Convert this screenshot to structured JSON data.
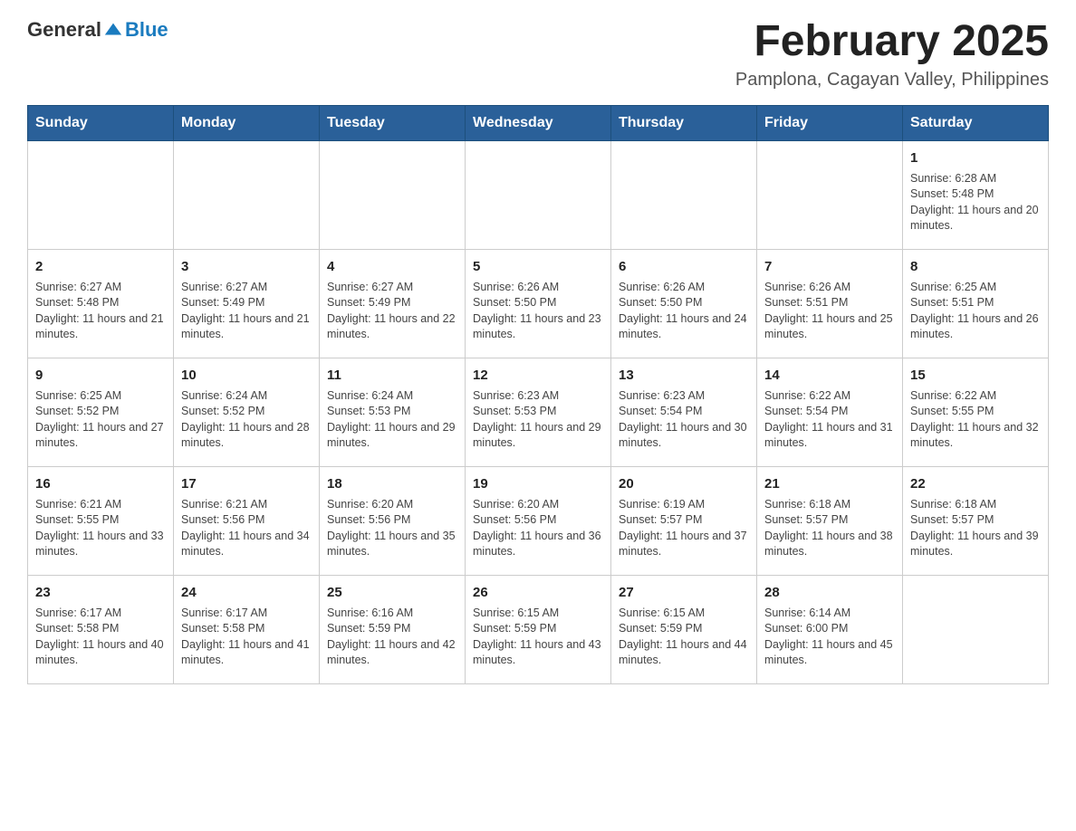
{
  "header": {
    "logo_general": "General",
    "logo_blue": "Blue",
    "title": "February 2025",
    "subtitle": "Pamplona, Cagayan Valley, Philippines"
  },
  "days_of_week": [
    "Sunday",
    "Monday",
    "Tuesday",
    "Wednesday",
    "Thursday",
    "Friday",
    "Saturday"
  ],
  "weeks": [
    [
      {
        "day": "",
        "info": ""
      },
      {
        "day": "",
        "info": ""
      },
      {
        "day": "",
        "info": ""
      },
      {
        "day": "",
        "info": ""
      },
      {
        "day": "",
        "info": ""
      },
      {
        "day": "",
        "info": ""
      },
      {
        "day": "1",
        "info": "Sunrise: 6:28 AM\nSunset: 5:48 PM\nDaylight: 11 hours and 20 minutes."
      }
    ],
    [
      {
        "day": "2",
        "info": "Sunrise: 6:27 AM\nSunset: 5:48 PM\nDaylight: 11 hours and 21 minutes."
      },
      {
        "day": "3",
        "info": "Sunrise: 6:27 AM\nSunset: 5:49 PM\nDaylight: 11 hours and 21 minutes."
      },
      {
        "day": "4",
        "info": "Sunrise: 6:27 AM\nSunset: 5:49 PM\nDaylight: 11 hours and 22 minutes."
      },
      {
        "day": "5",
        "info": "Sunrise: 6:26 AM\nSunset: 5:50 PM\nDaylight: 11 hours and 23 minutes."
      },
      {
        "day": "6",
        "info": "Sunrise: 6:26 AM\nSunset: 5:50 PM\nDaylight: 11 hours and 24 minutes."
      },
      {
        "day": "7",
        "info": "Sunrise: 6:26 AM\nSunset: 5:51 PM\nDaylight: 11 hours and 25 minutes."
      },
      {
        "day": "8",
        "info": "Sunrise: 6:25 AM\nSunset: 5:51 PM\nDaylight: 11 hours and 26 minutes."
      }
    ],
    [
      {
        "day": "9",
        "info": "Sunrise: 6:25 AM\nSunset: 5:52 PM\nDaylight: 11 hours and 27 minutes."
      },
      {
        "day": "10",
        "info": "Sunrise: 6:24 AM\nSunset: 5:52 PM\nDaylight: 11 hours and 28 minutes."
      },
      {
        "day": "11",
        "info": "Sunrise: 6:24 AM\nSunset: 5:53 PM\nDaylight: 11 hours and 29 minutes."
      },
      {
        "day": "12",
        "info": "Sunrise: 6:23 AM\nSunset: 5:53 PM\nDaylight: 11 hours and 29 minutes."
      },
      {
        "day": "13",
        "info": "Sunrise: 6:23 AM\nSunset: 5:54 PM\nDaylight: 11 hours and 30 minutes."
      },
      {
        "day": "14",
        "info": "Sunrise: 6:22 AM\nSunset: 5:54 PM\nDaylight: 11 hours and 31 minutes."
      },
      {
        "day": "15",
        "info": "Sunrise: 6:22 AM\nSunset: 5:55 PM\nDaylight: 11 hours and 32 minutes."
      }
    ],
    [
      {
        "day": "16",
        "info": "Sunrise: 6:21 AM\nSunset: 5:55 PM\nDaylight: 11 hours and 33 minutes."
      },
      {
        "day": "17",
        "info": "Sunrise: 6:21 AM\nSunset: 5:56 PM\nDaylight: 11 hours and 34 minutes."
      },
      {
        "day": "18",
        "info": "Sunrise: 6:20 AM\nSunset: 5:56 PM\nDaylight: 11 hours and 35 minutes."
      },
      {
        "day": "19",
        "info": "Sunrise: 6:20 AM\nSunset: 5:56 PM\nDaylight: 11 hours and 36 minutes."
      },
      {
        "day": "20",
        "info": "Sunrise: 6:19 AM\nSunset: 5:57 PM\nDaylight: 11 hours and 37 minutes."
      },
      {
        "day": "21",
        "info": "Sunrise: 6:18 AM\nSunset: 5:57 PM\nDaylight: 11 hours and 38 minutes."
      },
      {
        "day": "22",
        "info": "Sunrise: 6:18 AM\nSunset: 5:57 PM\nDaylight: 11 hours and 39 minutes."
      }
    ],
    [
      {
        "day": "23",
        "info": "Sunrise: 6:17 AM\nSunset: 5:58 PM\nDaylight: 11 hours and 40 minutes."
      },
      {
        "day": "24",
        "info": "Sunrise: 6:17 AM\nSunset: 5:58 PM\nDaylight: 11 hours and 41 minutes."
      },
      {
        "day": "25",
        "info": "Sunrise: 6:16 AM\nSunset: 5:59 PM\nDaylight: 11 hours and 42 minutes."
      },
      {
        "day": "26",
        "info": "Sunrise: 6:15 AM\nSunset: 5:59 PM\nDaylight: 11 hours and 43 minutes."
      },
      {
        "day": "27",
        "info": "Sunrise: 6:15 AM\nSunset: 5:59 PM\nDaylight: 11 hours and 44 minutes."
      },
      {
        "day": "28",
        "info": "Sunrise: 6:14 AM\nSunset: 6:00 PM\nDaylight: 11 hours and 45 minutes."
      },
      {
        "day": "",
        "info": ""
      }
    ]
  ]
}
